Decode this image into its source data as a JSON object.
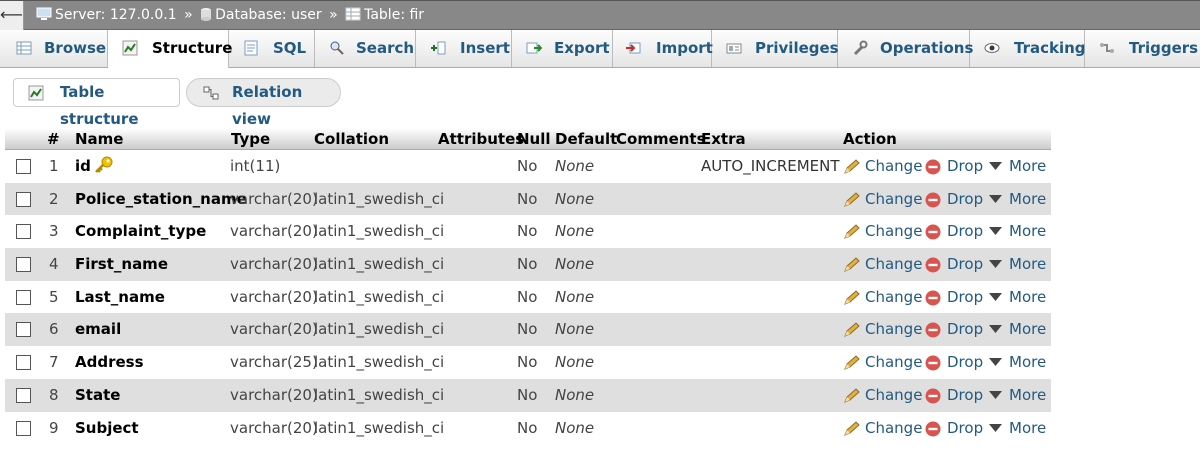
{
  "breadcrumb": {
    "back_glyph": "⟵",
    "server": "Server: 127.0.0.1",
    "database": "Database: user",
    "table": "Table: fir",
    "separator": "»"
  },
  "tabs": [
    {
      "label": "Browse",
      "icon": "browse-icon",
      "active": false
    },
    {
      "label": "Structure",
      "icon": "structure-icon",
      "active": true
    },
    {
      "label": "SQL",
      "icon": "sql-icon",
      "active": false
    },
    {
      "label": "Search",
      "icon": "search-icon",
      "active": false
    },
    {
      "label": "Insert",
      "icon": "insert-icon",
      "active": false
    },
    {
      "label": "Export",
      "icon": "export-icon",
      "active": false
    },
    {
      "label": "Import",
      "icon": "import-icon",
      "active": false
    },
    {
      "label": "Privileges",
      "icon": "privileges-icon",
      "active": false
    },
    {
      "label": "Operations",
      "icon": "wrench-icon",
      "active": false
    },
    {
      "label": "Tracking",
      "icon": "eye-icon",
      "active": false
    },
    {
      "label": "Triggers",
      "icon": "triggers-icon",
      "active": false
    }
  ],
  "subnav": {
    "table_structure": "Table structure",
    "relation_view": "Relation view"
  },
  "columns": {
    "num": "#",
    "name": "Name",
    "type": "Type",
    "collation": "Collation",
    "attributes": "Attributes",
    "null": "Null",
    "default": "Default",
    "comments": "Comments",
    "extra": "Extra",
    "action": "Action"
  },
  "actions": {
    "change": "Change",
    "drop": "Drop",
    "more": "More"
  },
  "rows": [
    {
      "num": "1",
      "name": "id",
      "primary_key": true,
      "type": "int(11)",
      "collation": "",
      "null": "No",
      "default": "None",
      "extra": "AUTO_INCREMENT"
    },
    {
      "num": "2",
      "name": "Police_station_name",
      "type": "varchar(20)",
      "collation": "latin1_swedish_ci",
      "null": "No",
      "default": "None",
      "extra": ""
    },
    {
      "num": "3",
      "name": "Complaint_type",
      "type": "varchar(20)",
      "collation": "latin1_swedish_ci",
      "null": "No",
      "default": "None",
      "extra": ""
    },
    {
      "num": "4",
      "name": "First_name",
      "type": "varchar(20)",
      "collation": "latin1_swedish_ci",
      "null": "No",
      "default": "None",
      "extra": ""
    },
    {
      "num": "5",
      "name": "Last_name",
      "type": "varchar(20)",
      "collation": "latin1_swedish_ci",
      "null": "No",
      "default": "None",
      "extra": ""
    },
    {
      "num": "6",
      "name": "email",
      "type": "varchar(20)",
      "collation": "latin1_swedish_ci",
      "null": "No",
      "default": "None",
      "extra": ""
    },
    {
      "num": "7",
      "name": "Address",
      "type": "varchar(25)",
      "collation": "latin1_swedish_ci",
      "null": "No",
      "default": "None",
      "extra": ""
    },
    {
      "num": "8",
      "name": "State",
      "type": "varchar(20)",
      "collation": "latin1_swedish_ci",
      "null": "No",
      "default": "None",
      "extra": ""
    },
    {
      "num": "9",
      "name": "Subject",
      "type": "varchar(20)",
      "collation": "latin1_swedish_ci",
      "null": "No",
      "default": "None",
      "extra": ""
    }
  ],
  "colors": {
    "link": "#235a81",
    "drop_red": "#d9534f",
    "pencil": "#e0b040",
    "key_gold": "#f2c200"
  }
}
